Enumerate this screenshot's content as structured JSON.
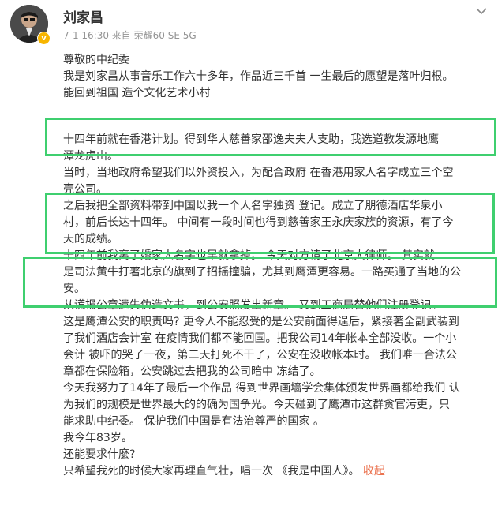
{
  "post": {
    "author": "刘家昌",
    "meta": "7-1 16:30 来自 荣耀60 SE 5G",
    "lines_a": [
      "尊敬的中纪委",
      "我是刘家昌从事音乐工作六十多年，作品近三千首 一生最后的愿望是落叶归根。",
      "能回到祖国  造个文化艺术小村"
    ],
    "lines_b": [
      "       十四年前就在香港计划。得到华人慈善家邵逸夫夫人支助，我选道教发源地鹰",
      "潭龙虎山。",
      "当时，当地政府希望我们以外资投入，为配合政府 在香港用家人名字成立三个空",
      "壳公司。",
      "之后我把全部资料带到中国以我一个人名字独资 登记。成立了朋德酒店华泉小",
      "村，前后长达十四年。  中间有一段时间也得到慈善家王永庆家族的资源，有了今",
      "天的成绩。",
      "       十四年前我离了婚家人名字也早就拿掉。   今天对方请了北京大律师。 其实就",
      "是司法黄牛打著北京的旗到了招摇撞骗，尤其到鹰潭更容易。一路买通了当地的公",
      "安。",
      "     从谎报公章遗失伪造文书，到公安照发出新章。  又到工商局替他们注册登记。",
      "这是鹰潭公安的职责吗? 更令人不能忍受的是公安前面得逞后，紧接著全副武装到",
      "了我们酒店会计室 在疫情我们都不能回国。把我公司14年帐本全部没收。一个小",
      "会计 被吓的哭了一夜，第二天打死不干了，公安在没收帐本时。  我们唯一合法公",
      "章都在保险箱，公安跳过去把我的公司暗中 冻结了。",
      "今天我努力了14年了最后一个作品 得到世界画墙学会集体颁发世界画都给我们 认",
      "为我们的规模是世界最大的的确为国争光。今天碰到了鹰潭市这群贪官污吏，只",
      "能求助中纪委。  保护我们中国是有法治尊严的国家  。",
      "我今年83岁。",
      "还能要求什麼?"
    ],
    "last_line": "只希望我死的时候大家再理直气壮，唱一次 《我是中国人》。",
    "collapse_label": "收起"
  },
  "highlight_color": "#3fcf6f",
  "link_color": "#eb7350",
  "icons": {
    "more": "chevron-down-icon",
    "badge": "verified-badge-icon"
  }
}
